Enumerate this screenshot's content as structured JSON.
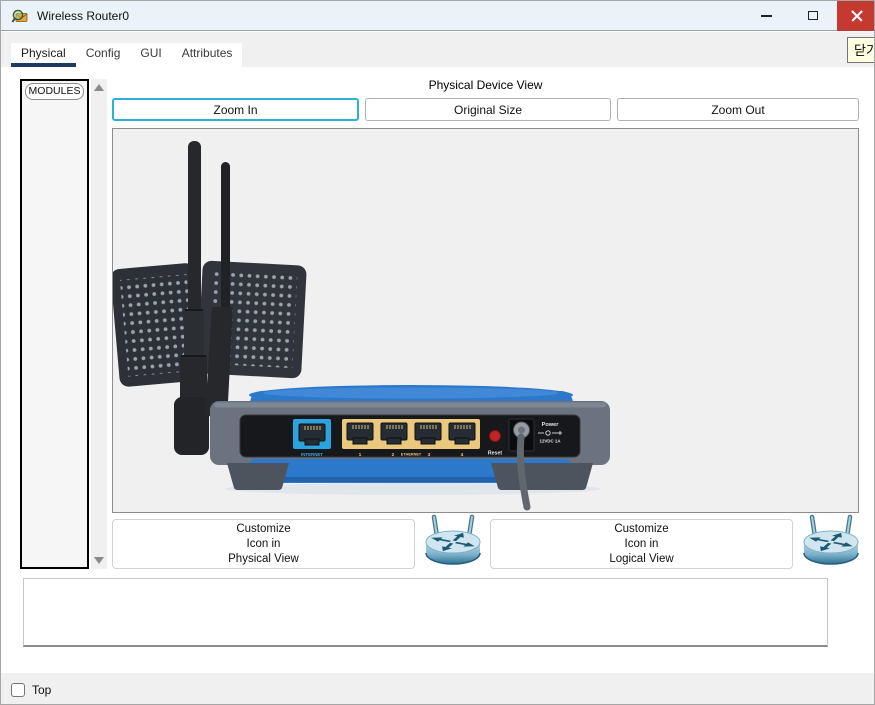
{
  "window": {
    "title": "Wireless Router0"
  },
  "window_controls": {
    "minimize": "minimize",
    "maximize": "maximize",
    "close": "close"
  },
  "tooltip": {
    "text": "닫기"
  },
  "tabs": {
    "items": [
      {
        "label": "Physical",
        "active": true
      },
      {
        "label": "Config",
        "active": false
      },
      {
        "label": "GUI",
        "active": false
      },
      {
        "label": "Attributes",
        "active": false
      }
    ]
  },
  "modules_panel": {
    "header": "MODULES"
  },
  "physical_view": {
    "title": "Physical Device View",
    "buttons": [
      "Zoom In",
      "Original Size",
      "Zoom Out"
    ]
  },
  "router_labels": {
    "internet": "INTERNET",
    "port1": "1",
    "port2": "2",
    "ethernet": "ETHERNET",
    "port3": "3",
    "port4": "4",
    "reset": "Reset",
    "power": "Power",
    "power_spec": "12VDC 1A"
  },
  "customize": {
    "physical": {
      "line1": "Customize",
      "line2": "Icon in",
      "line3": "Physical View"
    },
    "logical": {
      "line1": "Customize",
      "line2": "Icon in",
      "line3": "Logical View"
    }
  },
  "status_bar": {
    "top_label": "Top",
    "top_checked": false
  },
  "colors": {
    "router_blue": "#2c79cb",
    "port_yellow": "#eac87e",
    "internet_cyan": "#2aa3de",
    "reset_red": "#c02425",
    "close_red": "#c43a30",
    "tab_underline": "#1f3a63",
    "focus_teal": "#2fb0d9",
    "tooltip_yellow": "#ffffe1"
  }
}
